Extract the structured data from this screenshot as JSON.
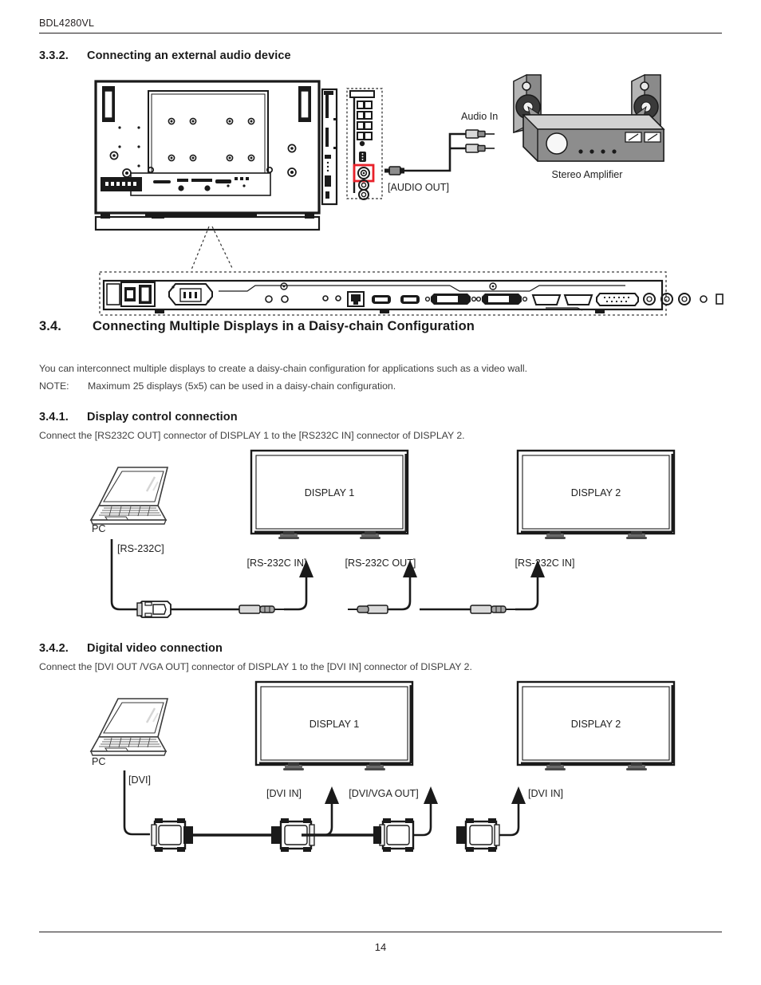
{
  "header": {
    "model": "BDL4280VL"
  },
  "footer": {
    "page_number": "14"
  },
  "sections": {
    "s332": {
      "number": "3.3.2.",
      "title": "Connecting an external audio device"
    },
    "s34": {
      "number": "3.4.",
      "title": "Connecting Multiple Displays in a Daisy-chain Configuration",
      "body": "You can interconnect multiple displays to create a daisy-chain configuration for applications such as a video wall.",
      "note_label": "NOTE:",
      "note_text": "Maximum 25 displays (5x5) can be used in a daisy-chain configuration."
    },
    "s341": {
      "number": "3.4.1.",
      "title": "Display control connection",
      "body": "Connect the [RS232C OUT] connector of DISPLAY 1 to the [RS232C IN] connector of DISPLAY 2."
    },
    "s342": {
      "number": "3.4.2.",
      "title": "Digital video connection",
      "body": "Connect the [DVI OUT /VGA OUT] connector of DISPLAY 1 to the [DVI IN] connector of DISPLAY 2."
    }
  },
  "audio_diagram": {
    "audio_in_label": "Audio In",
    "audio_out_label": "[AUDIO OUT]",
    "amplifier_label": "Stereo Amplifier",
    "highlight_color": "#e8212a",
    "amp_body_color": "#8d8d8d",
    "speaker_color": "#a0a0a0"
  },
  "rs232_diagram": {
    "pc_label": "PC",
    "pc_port_label": "[RS-232C]",
    "display1_label": "DISPLAY 1",
    "display2_label": "DISPLAY 2",
    "d1_in_label": "[RS-232C IN]",
    "d1_out_label": "[RS-232C OUT]",
    "d2_in_label": "[RS-232C IN]"
  },
  "dvi_diagram": {
    "pc_label": "PC",
    "pc_port_label": "[DVI]",
    "display1_label": "DISPLAY 1",
    "display2_label": "DISPLAY 2",
    "d1_in_label": "[DVI IN]",
    "d1_out_label": "[DVI/VGA OUT]",
    "d2_in_label": "[DVI IN]"
  }
}
